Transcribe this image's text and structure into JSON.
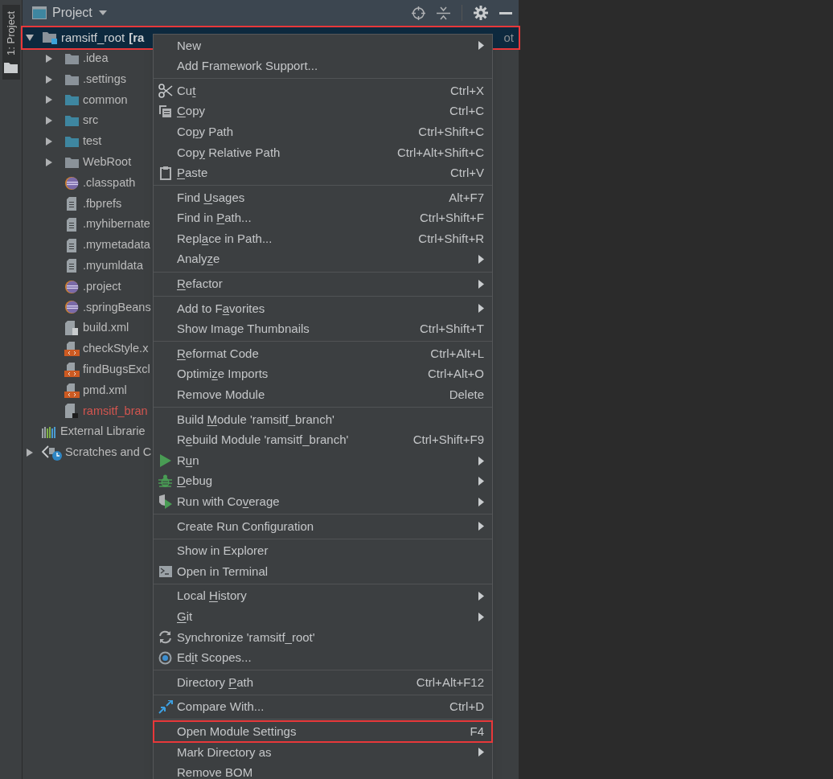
{
  "side_tab": {
    "label": "1: Project"
  },
  "panel": {
    "title": "Project"
  },
  "tree": {
    "root": {
      "name": "ramsitf_root",
      "module": "[ra",
      "path_tail": "ot",
      "expanded": true,
      "selected": true,
      "highlighted": true
    },
    "children": [
      {
        "kind": "folder",
        "label": ".idea",
        "expanded": false,
        "ignored": false
      },
      {
        "kind": "folder",
        "label": ".settings",
        "expanded": false,
        "ignored": false
      },
      {
        "kind": "source-folder",
        "label": "common",
        "expanded": false,
        "ignored": false
      },
      {
        "kind": "source-folder",
        "label": "src",
        "expanded": false,
        "ignored": false
      },
      {
        "kind": "source-folder",
        "label": "test",
        "expanded": false,
        "ignored": false
      },
      {
        "kind": "folder",
        "label": "WebRoot",
        "expanded": false,
        "ignored": false
      },
      {
        "kind": "eclipse",
        "label": ".classpath",
        "ignored": false
      },
      {
        "kind": "text",
        "label": ".fbprefs",
        "ignored": false
      },
      {
        "kind": "text",
        "label": ".myhibernate",
        "ignored": false
      },
      {
        "kind": "text",
        "label": ".mymetadata",
        "ignored": false
      },
      {
        "kind": "text",
        "label": ".myumldata",
        "ignored": false
      },
      {
        "kind": "eclipse",
        "label": ".project",
        "ignored": false
      },
      {
        "kind": "eclipse",
        "label": ".springBeans",
        "ignored": false
      },
      {
        "kind": "build",
        "label": "build.xml",
        "ignored": false
      },
      {
        "kind": "xml",
        "label": "checkStyle.x",
        "ignored": false
      },
      {
        "kind": "xml",
        "label": "findBugsExcl",
        "ignored": false
      },
      {
        "kind": "xml",
        "label": "pmd.xml",
        "ignored": false
      },
      {
        "kind": "module",
        "label": "ramsitf_bran",
        "ignored": true
      }
    ],
    "extras": [
      {
        "kind": "library",
        "label": "External Librarie"
      },
      {
        "kind": "scratches",
        "label": "Scratches and C",
        "expanded": false
      }
    ]
  },
  "menu": [
    [
      {
        "label": "New",
        "submenu": true
      },
      {
        "label": "Add Framework Support..."
      }
    ],
    [
      {
        "kind": "cut",
        "label": "Cu",
        "mnemonic": "t",
        "shortcut": "Ctrl+X"
      },
      {
        "kind": "copy",
        "mnemonic": "C",
        "after": "opy",
        "shortcut": "Ctrl+C"
      },
      {
        "label": "Co",
        "mnemonic": "p",
        "after": "y Path",
        "shortcut": "Ctrl+Shift+C"
      },
      {
        "label": "Cop",
        "mnemonic": "y",
        "after": " Relative Path",
        "shortcut": "Ctrl+Alt+Shift+C"
      },
      {
        "kind": "paste",
        "mnemonic": "P",
        "after": "aste",
        "shortcut": "Ctrl+V"
      }
    ],
    [
      {
        "label": "Find ",
        "mnemonic": "U",
        "after": "sages",
        "shortcut": "Alt+F7"
      },
      {
        "label": "Find in ",
        "mnemonic": "P",
        "after": "ath...",
        "shortcut": "Ctrl+Shift+F"
      },
      {
        "label": "Repl",
        "mnemonic": "a",
        "after": "ce in Path...",
        "shortcut": "Ctrl+Shift+R"
      },
      {
        "label": "Analy",
        "mnemonic": "z",
        "after": "e",
        "submenu": true
      }
    ],
    [
      {
        "mnemonic": "R",
        "after": "efactor",
        "submenu": true
      }
    ],
    [
      {
        "label": "Add to F",
        "mnemonic": "a",
        "after": "vorites",
        "submenu": true
      },
      {
        "label": "Show Image Thumbnails",
        "shortcut": "Ctrl+Shift+T"
      }
    ],
    [
      {
        "mnemonic": "R",
        "after": "eformat Code",
        "shortcut": "Ctrl+Alt+L"
      },
      {
        "label": "Optimi",
        "mnemonic": "z",
        "after": "e Imports",
        "shortcut": "Ctrl+Alt+O"
      },
      {
        "label": "Remove Module",
        "shortcut": "Delete"
      }
    ],
    [
      {
        "label": "Build ",
        "mnemonic": "M",
        "after": "odule 'ramsitf_branch'"
      },
      {
        "label": "R",
        "mnemonic": "e",
        "after": "build Module 'ramsitf_branch'",
        "shortcut": "Ctrl+Shift+F9"
      },
      {
        "kind": "run",
        "label": "R",
        "mnemonic": "u",
        "after": "n",
        "submenu": true
      },
      {
        "kind": "debug",
        "mnemonic": "D",
        "after": "ebug",
        "submenu": true
      },
      {
        "kind": "coverage",
        "label": "Run with Co",
        "mnemonic": "v",
        "after": "erage",
        "submenu": true
      }
    ],
    [
      {
        "label": "Create Run Configuration",
        "submenu": true
      }
    ],
    [
      {
        "label": "Show in Explorer"
      },
      {
        "kind": "terminal",
        "label": "Open in Terminal"
      }
    ],
    [
      {
        "label": "Local ",
        "mnemonic": "H",
        "after": "istory",
        "submenu": true
      },
      {
        "mnemonic": "G",
        "after": "it",
        "submenu": true
      },
      {
        "kind": "sync",
        "label": "Synchronize 'ramsitf_root'"
      },
      {
        "kind": "scopes",
        "label": "Ed",
        "mnemonic": "i",
        "after": "t Scopes..."
      }
    ],
    [
      {
        "label": "Directory ",
        "mnemonic": "P",
        "after": "ath",
        "shortcut": "Ctrl+Alt+F12"
      }
    ],
    [
      {
        "kind": "compare",
        "label": "Compare With...",
        "shortcut": "Ctrl+D"
      }
    ],
    [
      {
        "label": "Open Module Settings",
        "shortcut": "F4",
        "highlighted": true
      },
      {
        "label": "Mark Directory as",
        "submenu": true
      },
      {
        "label": "Remove BOM"
      }
    ]
  ]
}
